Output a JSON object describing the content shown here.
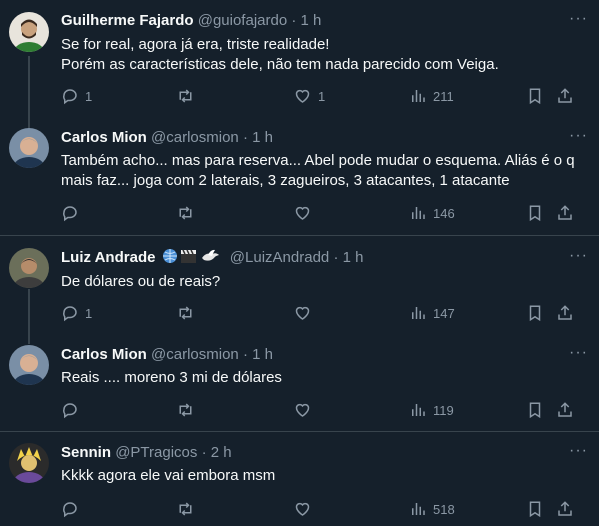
{
  "tweets": [
    {
      "name": "Guilherme Fajardo",
      "handle": "@guiofajardo",
      "time": "1 h",
      "text_lines": [
        "Se for real, agora já era, triste realidade!",
        "Porém as características dele, não tem nada parecido com Veiga."
      ],
      "replies": "1",
      "retweets": "",
      "likes": "1",
      "views": "211",
      "avatar": {
        "bg": "#e8e4dc",
        "skin": "#c9a27e",
        "hair": "#3b2a1e",
        "shirt": "#2e7d32"
      }
    },
    {
      "name": "Carlos Mion",
      "handle": "@carlosmion",
      "time": "1 h",
      "text_lines": [
        "Também acho... mas para reserva... Abel pode mudar o esquema. Aliás é o q",
        "mais faz... joga com 2 laterais, 3 zagueiros, 3 atacantes, 1 atacante"
      ],
      "replies": "",
      "retweets": "",
      "likes": "",
      "views": "146",
      "avatar": {
        "bg": "#7a8fa6",
        "skin": "#d8b094",
        "hair": "#9a9a9a",
        "shirt": "#1f3550"
      }
    },
    {
      "name": "Luiz Andrade",
      "handle": "@LuizAndradd",
      "time": "1 h",
      "text_lines": [
        "De dólares ou de reais?"
      ],
      "replies": "1",
      "retweets": "",
      "likes": "",
      "views": "147",
      "badges": [
        "🌐",
        "🎬",
        "🕊"
      ],
      "avatar": {
        "bg": "#6b6f5a",
        "skin": "#b58c6a",
        "hair": "#2a2a2a",
        "shirt": "#3d3d3d"
      }
    },
    {
      "name": "Carlos Mion",
      "handle": "@carlosmion",
      "time": "1 h",
      "text_lines": [
        "Reais .... moreno 3 mi de dólares"
      ],
      "replies": "",
      "retweets": "",
      "likes": "",
      "views": "119",
      "avatar": {
        "bg": "#7a8fa6",
        "skin": "#d8b094",
        "hair": "#9a9a9a",
        "shirt": "#1f3550"
      }
    },
    {
      "name": "Sennin",
      "handle": "@PTragicos",
      "time": "2 h",
      "text_lines": [
        "Kkkk agora ele vai embora msm"
      ],
      "replies": "",
      "retweets": "",
      "likes": "",
      "views": "518",
      "avatar": {
        "bg": "#2b2b2b",
        "skin": "#e0c070",
        "hair": "#f2d24a",
        "shirt": "#6a4a9a"
      }
    }
  ],
  "separator": "·",
  "colors": {
    "background": "#15202b",
    "text": "#f7f9f9",
    "muted": "#8b98a5",
    "border": "#38444d"
  }
}
